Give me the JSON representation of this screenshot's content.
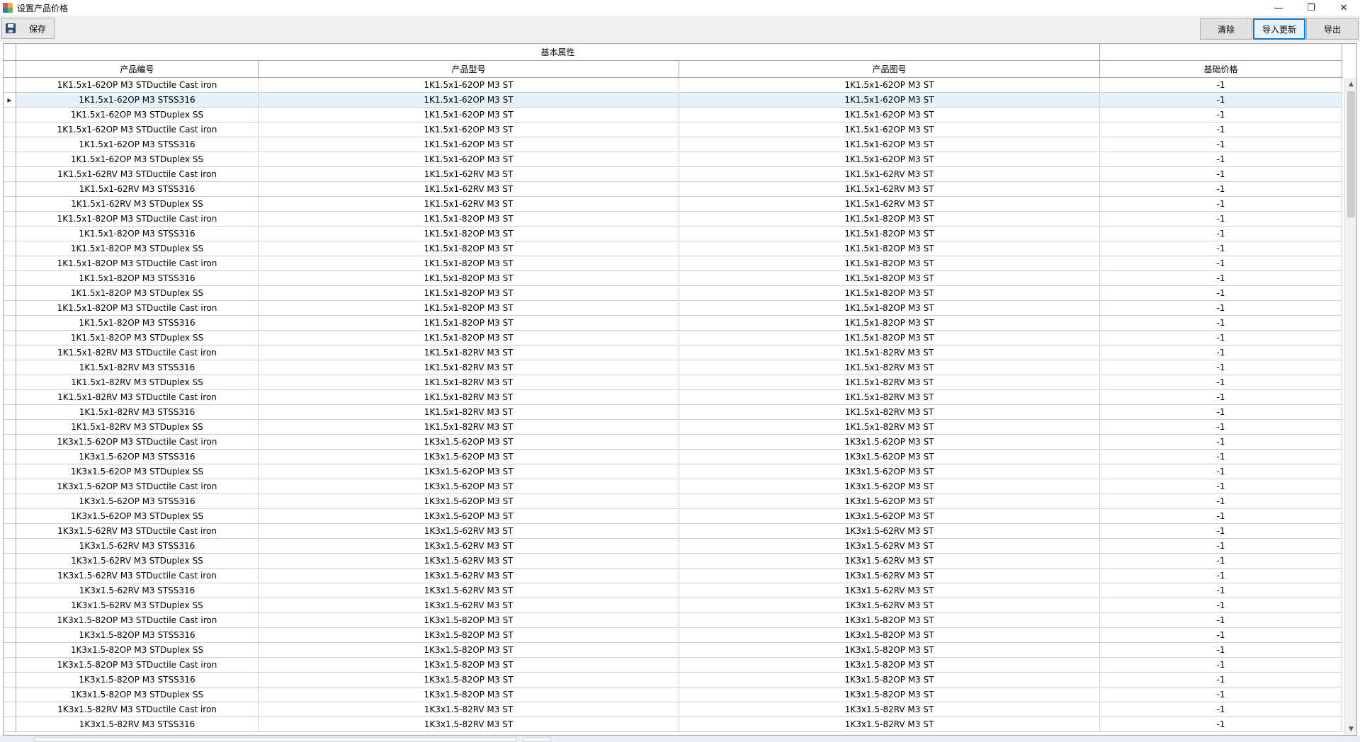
{
  "window": {
    "title": "设置产品价格",
    "minimize_glyph": "—",
    "restore_glyph": "❐",
    "close_glyph": "✕"
  },
  "toolbar": {
    "save_label": "保存",
    "clear_label": "清除",
    "import_label": "导入更新",
    "export_label": "导出"
  },
  "grid": {
    "group_header": "基本属性",
    "columns": [
      "产品编号",
      "产品型号",
      "产品图号",
      "基础价格"
    ],
    "selected_row_index": 1,
    "rows": [
      [
        "1K1.5x1-62OP M3 STDuctile Cast iron",
        "1K1.5x1-62OP M3 ST",
        "1K1.5x1-62OP M3 ST",
        "-1"
      ],
      [
        "1K1.5x1-62OP M3 STSS316",
        "1K1.5x1-62OP M3 ST",
        "1K1.5x1-62OP M3 ST",
        "-1"
      ],
      [
        "1K1.5x1-62OP M3 STDuplex SS",
        "1K1.5x1-62OP M3 ST",
        "1K1.5x1-62OP M3 ST",
        "-1"
      ],
      [
        "1K1.5x1-62OP M3 STDuctile Cast iron",
        "1K1.5x1-62OP M3 ST",
        "1K1.5x1-62OP M3 ST",
        "-1"
      ],
      [
        "1K1.5x1-62OP M3 STSS316",
        "1K1.5x1-62OP M3 ST",
        "1K1.5x1-62OP M3 ST",
        "-1"
      ],
      [
        "1K1.5x1-62OP M3 STDuplex SS",
        "1K1.5x1-62OP M3 ST",
        "1K1.5x1-62OP M3 ST",
        "-1"
      ],
      [
        "1K1.5x1-62RV M3 STDuctile Cast iron",
        "1K1.5x1-62RV M3 ST",
        "1K1.5x1-62RV M3 ST",
        "-1"
      ],
      [
        "1K1.5x1-62RV M3 STSS316",
        "1K1.5x1-62RV M3 ST",
        "1K1.5x1-62RV M3 ST",
        "-1"
      ],
      [
        "1K1.5x1-62RV M3 STDuplex SS",
        "1K1.5x1-62RV M3 ST",
        "1K1.5x1-62RV M3 ST",
        "-1"
      ],
      [
        "1K1.5x1-82OP M3 STDuctile Cast iron",
        "1K1.5x1-82OP M3 ST",
        "1K1.5x1-82OP M3 ST",
        "-1"
      ],
      [
        "1K1.5x1-82OP M3 STSS316",
        "1K1.5x1-82OP M3 ST",
        "1K1.5x1-82OP M3 ST",
        "-1"
      ],
      [
        "1K1.5x1-82OP M3 STDuplex SS",
        "1K1.5x1-82OP M3 ST",
        "1K1.5x1-82OP M3 ST",
        "-1"
      ],
      [
        "1K1.5x1-82OP M3 STDuctile Cast iron",
        "1K1.5x1-82OP M3 ST",
        "1K1.5x1-82OP M3 ST",
        "-1"
      ],
      [
        "1K1.5x1-82OP M3 STSS316",
        "1K1.5x1-82OP M3 ST",
        "1K1.5x1-82OP M3 ST",
        "-1"
      ],
      [
        "1K1.5x1-82OP M3 STDuplex SS",
        "1K1.5x1-82OP M3 ST",
        "1K1.5x1-82OP M3 ST",
        "-1"
      ],
      [
        "1K1.5x1-82OP M3 STDuctile Cast iron",
        "1K1.5x1-82OP M3 ST",
        "1K1.5x1-82OP M3 ST",
        "-1"
      ],
      [
        "1K1.5x1-82OP M3 STSS316",
        "1K1.5x1-82OP M3 ST",
        "1K1.5x1-82OP M3 ST",
        "-1"
      ],
      [
        "1K1.5x1-82OP M3 STDuplex SS",
        "1K1.5x1-82OP M3 ST",
        "1K1.5x1-82OP M3 ST",
        "-1"
      ],
      [
        "1K1.5x1-82RV M3 STDuctile Cast iron",
        "1K1.5x1-82RV M3 ST",
        "1K1.5x1-82RV M3 ST",
        "-1"
      ],
      [
        "1K1.5x1-82RV M3 STSS316",
        "1K1.5x1-82RV M3 ST",
        "1K1.5x1-82RV M3 ST",
        "-1"
      ],
      [
        "1K1.5x1-82RV M3 STDuplex SS",
        "1K1.5x1-82RV M3 ST",
        "1K1.5x1-82RV M3 ST",
        "-1"
      ],
      [
        "1K1.5x1-82RV M3 STDuctile Cast iron",
        "1K1.5x1-82RV M3 ST",
        "1K1.5x1-82RV M3 ST",
        "-1"
      ],
      [
        "1K1.5x1-82RV M3 STSS316",
        "1K1.5x1-82RV M3 ST",
        "1K1.5x1-82RV M3 ST",
        "-1"
      ],
      [
        "1K1.5x1-82RV M3 STDuplex SS",
        "1K1.5x1-82RV M3 ST",
        "1K1.5x1-82RV M3 ST",
        "-1"
      ],
      [
        "1K3x1.5-62OP M3 STDuctile Cast iron",
        "1K3x1.5-62OP M3 ST",
        "1K3x1.5-62OP M3 ST",
        "-1"
      ],
      [
        "1K3x1.5-62OP M3 STSS316",
        "1K3x1.5-62OP M3 ST",
        "1K3x1.5-62OP M3 ST",
        "-1"
      ],
      [
        "1K3x1.5-62OP M3 STDuplex SS",
        "1K3x1.5-62OP M3 ST",
        "1K3x1.5-62OP M3 ST",
        "-1"
      ],
      [
        "1K3x1.5-62OP M3 STDuctile Cast iron",
        "1K3x1.5-62OP M3 ST",
        "1K3x1.5-62OP M3 ST",
        "-1"
      ],
      [
        "1K3x1.5-62OP M3 STSS316",
        "1K3x1.5-62OP M3 ST",
        "1K3x1.5-62OP M3 ST",
        "-1"
      ],
      [
        "1K3x1.5-62OP M3 STDuplex SS",
        "1K3x1.5-62OP M3 ST",
        "1K3x1.5-62OP M3 ST",
        "-1"
      ],
      [
        "1K3x1.5-62RV M3 STDuctile Cast iron",
        "1K3x1.5-62RV M3 ST",
        "1K3x1.5-62RV M3 ST",
        "-1"
      ],
      [
        "1K3x1.5-62RV M3 STSS316",
        "1K3x1.5-62RV M3 ST",
        "1K3x1.5-62RV M3 ST",
        "-1"
      ],
      [
        "1K3x1.5-62RV M3 STDuplex SS",
        "1K3x1.5-62RV M3 ST",
        "1K3x1.5-62RV M3 ST",
        "-1"
      ],
      [
        "1K3x1.5-62RV M3 STDuctile Cast iron",
        "1K3x1.5-62RV M3 ST",
        "1K3x1.5-62RV M3 ST",
        "-1"
      ],
      [
        "1K3x1.5-62RV M3 STSS316",
        "1K3x1.5-62RV M3 ST",
        "1K3x1.5-62RV M3 ST",
        "-1"
      ],
      [
        "1K3x1.5-62RV M3 STDuplex SS",
        "1K3x1.5-62RV M3 ST",
        "1K3x1.5-62RV M3 ST",
        "-1"
      ],
      [
        "1K3x1.5-82OP M3 STDuctile Cast iron",
        "1K3x1.5-82OP M3 ST",
        "1K3x1.5-82OP M3 ST",
        "-1"
      ],
      [
        "1K3x1.5-82OP M3 STSS316",
        "1K3x1.5-82OP M3 ST",
        "1K3x1.5-82OP M3 ST",
        "-1"
      ],
      [
        "1K3x1.5-82OP M3 STDuplex SS",
        "1K3x1.5-82OP M3 ST",
        "1K3x1.5-82OP M3 ST",
        "-1"
      ],
      [
        "1K3x1.5-82OP M3 STDuctile Cast iron",
        "1K3x1.5-82OP M3 ST",
        "1K3x1.5-82OP M3 ST",
        "-1"
      ],
      [
        "1K3x1.5-82OP M3 STSS316",
        "1K3x1.5-82OP M3 ST",
        "1K3x1.5-82OP M3 ST",
        "-1"
      ],
      [
        "1K3x1.5-82OP M3 STDuplex SS",
        "1K3x1.5-82OP M3 ST",
        "1K3x1.5-82OP M3 ST",
        "-1"
      ],
      [
        "1K3x1.5-82RV M3 STDuctile Cast iron",
        "1K3x1.5-82RV M3 ST",
        "1K3x1.5-82RV M3 ST",
        "-1"
      ],
      [
        "1K3x1.5-82RV M3 STSS316",
        "1K3x1.5-82RV M3 ST",
        "1K3x1.5-82RV M3 ST",
        "-1"
      ]
    ]
  },
  "icons": {
    "app": "app-icon",
    "save": "floppy-disk-icon",
    "row_indicator": "triangle-right-icon",
    "scroll_up": "arrow-up-icon",
    "scroll_down": "arrow-down-icon"
  },
  "colors": {
    "selected_row": "#e6f0fa",
    "focus_border": "#0078d7",
    "toolbar_bg": "#f0f0f0"
  }
}
